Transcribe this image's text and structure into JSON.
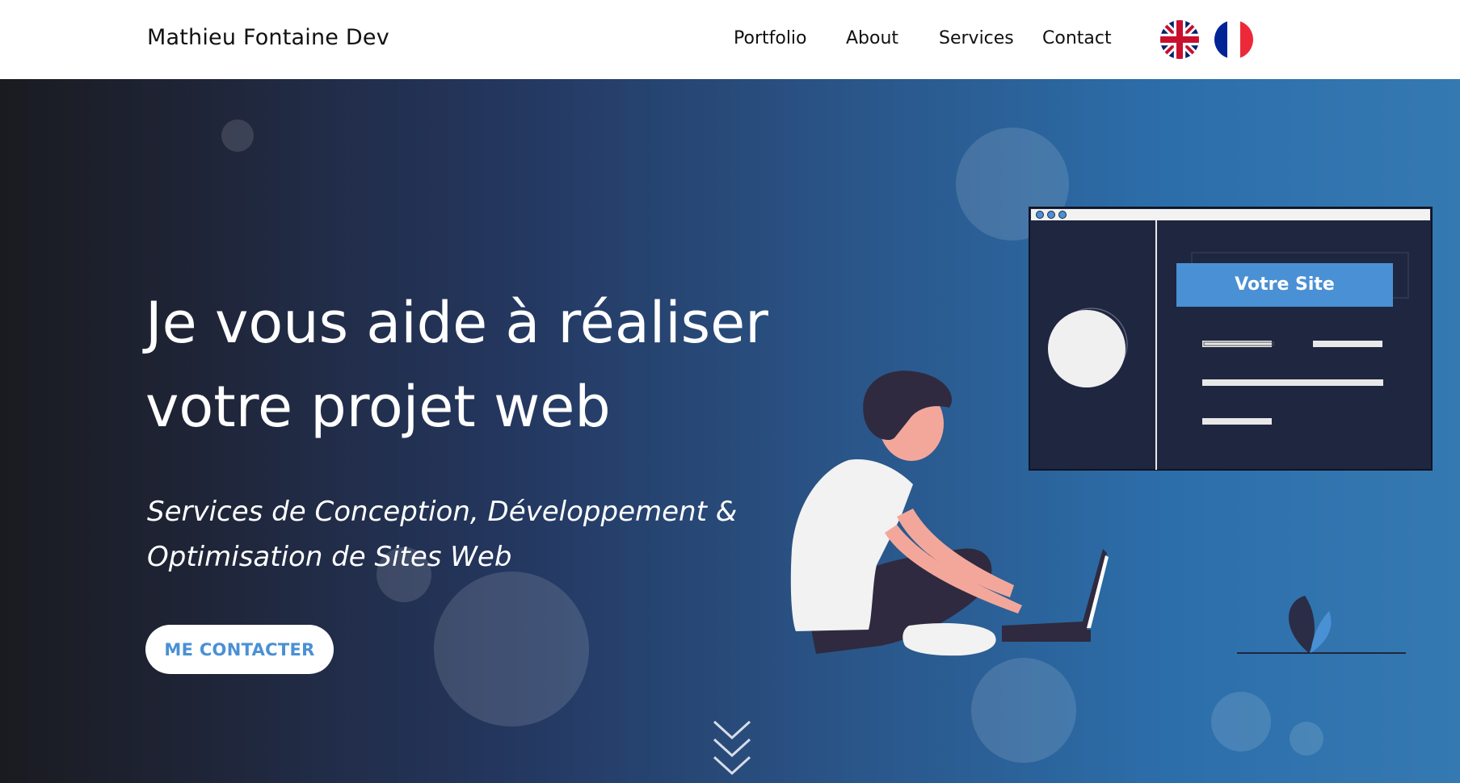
{
  "header": {
    "brand": "Mathieu Fontaine Dev",
    "nav": [
      "Portfolio",
      "About",
      "Services",
      "Contact"
    ],
    "languages": [
      {
        "code": "en",
        "icon": "uk-flag-icon"
      },
      {
        "code": "fr",
        "icon": "france-flag-icon"
      }
    ]
  },
  "hero": {
    "title_line1": "Je vous aide à réaliser",
    "title_line2": "votre projet web",
    "subtitle_line1": "Services de Conception, Développement &",
    "subtitle_line2": "Optimisation de Sites Web",
    "cta_label": "ME CONTACTER",
    "mockup_label": "Votre Site",
    "scroll_icon": "chevrons-down-icon"
  },
  "colors": {
    "accent": "#4a90d4",
    "hero_dark": "#1a1b20",
    "hero_light": "#3579b2",
    "mockup_bg": "#1f2640"
  }
}
